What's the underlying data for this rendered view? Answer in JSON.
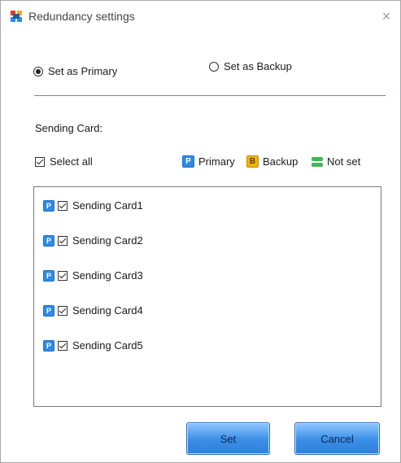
{
  "window": {
    "title": "Redundancy settings",
    "close_glyph": "×"
  },
  "mode": {
    "primary_label": "Set as Primary",
    "backup_label": "Set as Backup",
    "selected": "primary"
  },
  "sending_card": {
    "heading": "Sending Card:",
    "select_all_label": "Select all",
    "legend": {
      "primary_badge": "P",
      "primary_label": "Primary",
      "backup_badge": "B",
      "backup_label": "Backup",
      "notset_label": "Not set"
    },
    "cards": [
      {
        "badge": "P",
        "label": "Sending Card1"
      },
      {
        "badge": "P",
        "label": "Sending Card2"
      },
      {
        "badge": "P",
        "label": "Sending Card3"
      },
      {
        "badge": "P",
        "label": "Sending Card4"
      },
      {
        "badge": "P",
        "label": "Sending Card5"
      }
    ]
  },
  "buttons": {
    "set": "Set",
    "cancel": "Cancel"
  },
  "colors": {
    "primary_badge": "#2e8be6",
    "backup_badge": "#f0b400",
    "notset": "#45b45a",
    "separator": "#4a90d9"
  }
}
